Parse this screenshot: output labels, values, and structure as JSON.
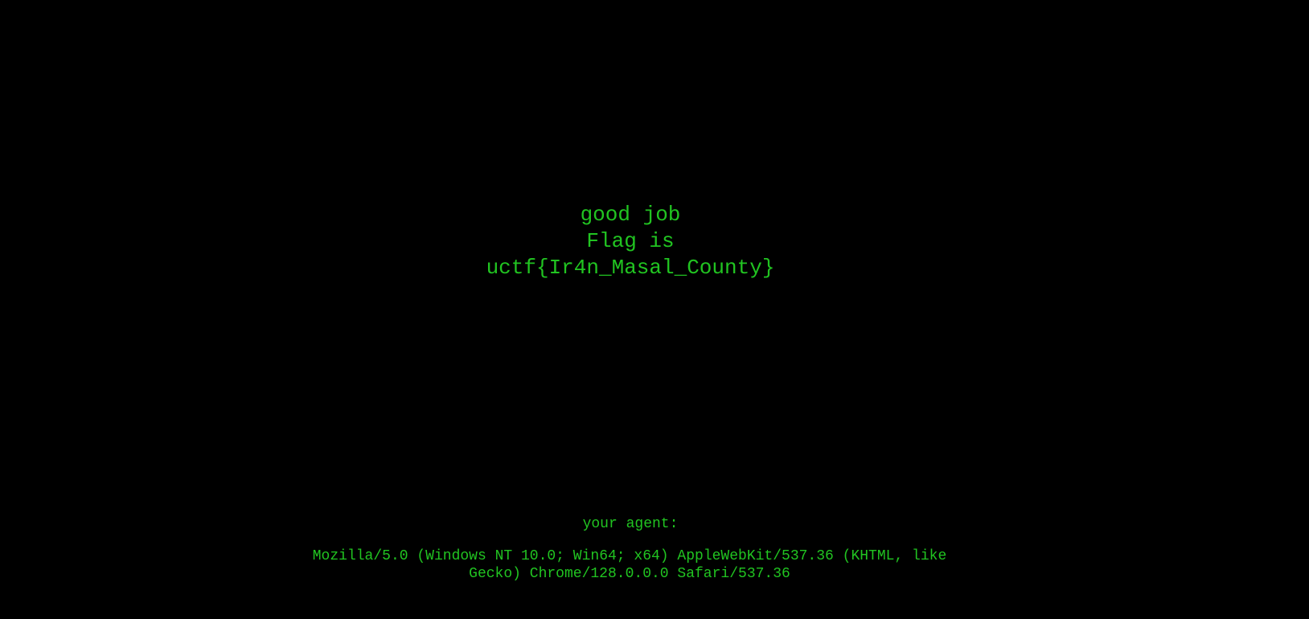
{
  "message": {
    "line1": "good job",
    "line2": "Flag is",
    "flag": "uctf{Ir4n_Masal_County}"
  },
  "agent": {
    "label": "your agent:",
    "user_agent": "Mozilla/5.0 (Windows NT 10.0; Win64; x64) AppleWebKit/537.36 (KHTML, like Gecko) Chrome/128.0.0.0 Safari/537.36"
  },
  "colors": {
    "background": "#000000",
    "text": "#21c421"
  }
}
